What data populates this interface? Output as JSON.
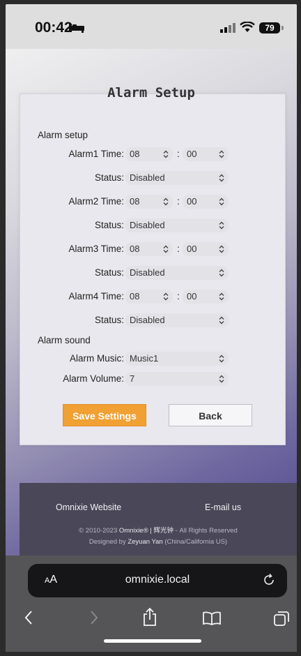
{
  "status_bar": {
    "time": "00:42",
    "battery": "79"
  },
  "card": {
    "title": "Alarm Setup",
    "alarm_setup_label": "Alarm setup",
    "alarms": [
      {
        "time_label": "Alarm1 Time:",
        "hour": "08",
        "minute": "00",
        "status_label": "Status:",
        "status": "Disabled"
      },
      {
        "time_label": "Alarm2 Time:",
        "hour": "08",
        "minute": "00",
        "status_label": "Status:",
        "status": "Disabled"
      },
      {
        "time_label": "Alarm3 Time:",
        "hour": "08",
        "minute": "00",
        "status_label": "Status:",
        "status": "Disabled"
      },
      {
        "time_label": "Alarm4 Time:",
        "hour": "08",
        "minute": "00",
        "status_label": "Status:",
        "status": "Disabled"
      }
    ],
    "colon": ":",
    "alarm_sound_label": "Alarm sound",
    "music_label": "Alarm Music:",
    "music_value": "Music1",
    "volume_label": "Alarm Volume:",
    "volume_value": "7",
    "save_label": "Save Settings",
    "back_label": "Back"
  },
  "footer": {
    "website_link": "Omnixie Website",
    "email_link": "E-mail us",
    "copyright_prefix": "© 2010-2023",
    "brand": "Omnixie® | 辉光钟",
    "rights": "- All Rights Reserved",
    "designed_by": "Designed by",
    "designer": "Zeyuan Yan",
    "location": "(China/California US)"
  },
  "browser": {
    "aa_small": "A",
    "aa_large": "A",
    "url": "omnixie.local"
  },
  "colors": {
    "accent": "#f1a033",
    "footer_bg": "#4a4858",
    "browser_bg": "#555457"
  }
}
